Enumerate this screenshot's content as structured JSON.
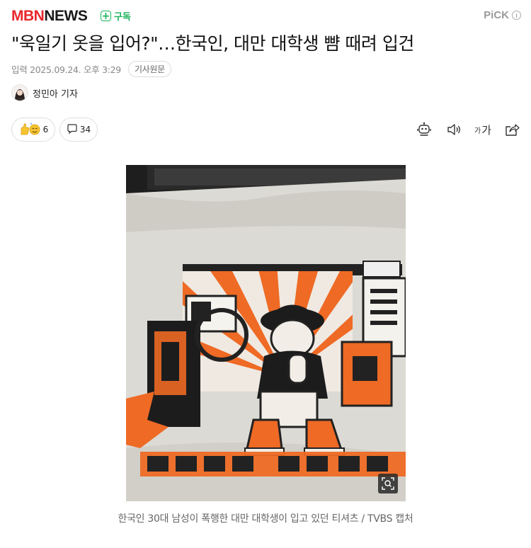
{
  "brand": {
    "mbn": "MBN",
    "news": "NEWS"
  },
  "subscribe": {
    "plus": "+",
    "label": "구독"
  },
  "pick": {
    "label": "PiCK",
    "info": "i"
  },
  "article": {
    "headline": "\"욱일기 옷을 입어?\"…한국인, 대만 대학생 뺨 때려 입건",
    "published": "입력 2025.09.24. 오후 3:29",
    "original_button": "기사원문",
    "reporter": "정민아 기자"
  },
  "reactions": {
    "count": "6",
    "comments": "34"
  },
  "toolbar": {
    "font_small": "가",
    "font_large": "가"
  },
  "photo": {
    "caption": "한국인 30대 남성이 폭행한 대만 대학생이 입고 있던 티셔츠 / TVBS 캡처"
  },
  "colors": {
    "brand_red": "#e8262c",
    "subscribe_green": "#1ab35b",
    "shirt_orange": "#ee6a25"
  }
}
